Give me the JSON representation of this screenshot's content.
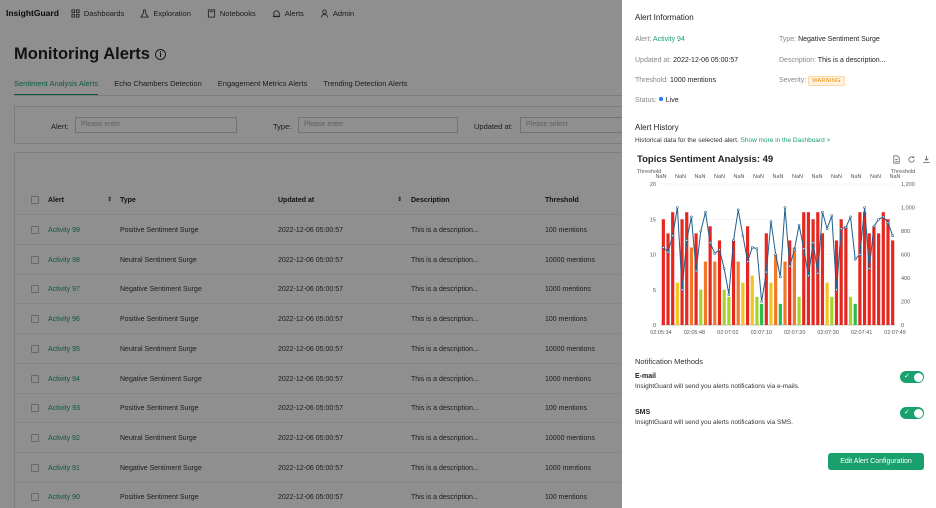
{
  "nav": {
    "brand": "InsightGuard",
    "items": [
      {
        "label": "Dashboards",
        "icon": "dashboard-icon"
      },
      {
        "label": "Exploration",
        "icon": "flask-icon"
      },
      {
        "label": "Notebooks",
        "icon": "notebook-icon"
      },
      {
        "label": "Alerts",
        "icon": "alert-icon"
      },
      {
        "label": "Admin",
        "icon": "user-icon"
      }
    ]
  },
  "page": {
    "title": "Monitoring Alerts"
  },
  "tabs": [
    "Sentiment Analysis Alerts",
    "Echo Chambers Detection",
    "Engagement Metrics Alerts",
    "Trending Detection Alerts"
  ],
  "filters": {
    "alert_label": "Alert:",
    "alert_placeholder": "Please enter",
    "type_label": "Type:",
    "type_placeholder": "Please enter",
    "updated_label": "Updated at:",
    "updated_placeholder": "Please select"
  },
  "table": {
    "headers": {
      "alert": "Alert",
      "type": "Type",
      "updated": "Updated at",
      "description": "Description",
      "threshold": "Threshold"
    },
    "rows": [
      {
        "alert": "Activity 99",
        "type": "Positive Sentiment Surge",
        "updated": "2022-12-06 05:00:57",
        "description": "This is a description...",
        "threshold": "100 mentions"
      },
      {
        "alert": "Activity 98",
        "type": "Neutral Sentiment Surge",
        "updated": "2022-12-06 05:00:57",
        "description": "This is a description...",
        "threshold": "10000 mentions"
      },
      {
        "alert": "Activity 97",
        "type": "Negative Sentiment Surge",
        "updated": "2022-12-06 05:00:57",
        "description": "This is a description...",
        "threshold": "1000 mentions"
      },
      {
        "alert": "Activity 96",
        "type": "Positive Sentiment Surge",
        "updated": "2022-12-06 05:00:57",
        "description": "This is a description...",
        "threshold": "100 mentions"
      },
      {
        "alert": "Activity 95",
        "type": "Neutral Sentiment Surge",
        "updated": "2022-12-06 05:00:57",
        "description": "This is a description...",
        "threshold": "10000 mentions"
      },
      {
        "alert": "Activity 94",
        "type": "Negative Sentiment Surge",
        "updated": "2022-12-06 05:00:57",
        "description": "This is a description...",
        "threshold": "1000 mentions"
      },
      {
        "alert": "Activity 93",
        "type": "Positive Sentiment Surge",
        "updated": "2022-12-06 05:00:57",
        "description": "This is a description...",
        "threshold": "100 mentions"
      },
      {
        "alert": "Activity 92",
        "type": "Neutral Sentiment Surge",
        "updated": "2022-12-06 05:00:57",
        "description": "This is a description...",
        "threshold": "10000 mentions"
      },
      {
        "alert": "Activity 91",
        "type": "Negative Sentiment Surge",
        "updated": "2022-12-06 05:00:57",
        "description": "This is a description...",
        "threshold": "1000 mentions"
      },
      {
        "alert": "Activity 90",
        "type": "Positive Sentiment Surge",
        "updated": "2022-12-06 05:00:57",
        "description": "This is a description...",
        "threshold": "100 mentions"
      }
    ]
  },
  "panel": {
    "info_title": "Alert Information",
    "alert_key": "Alert:",
    "alert_val": "Activity 94",
    "type_key": "Type:",
    "type_val": "Negative Sentiment Surge",
    "updated_key": "Updated at:",
    "updated_val": "2022-12-06 05:00:57",
    "desc_key": "Description:",
    "desc_val": "This is a description...",
    "threshold_key": "Threshold:",
    "threshold_val": "1000 mentions",
    "severity_key": "Severity:",
    "severity_val": "WARNING",
    "status_key": "Status:",
    "status_val": "Live",
    "history_title": "Alert History",
    "history_desc": "Historical data for the selected alert.",
    "history_link": "Show more in the Dashboard >",
    "notif_title": "Notification Methods",
    "email_name": "E-mail",
    "email_desc": "InsightGuard will send you alerts notifications via e-mails.",
    "email_enabled": true,
    "sms_name": "SMS",
    "sms_desc": "InsightGuard will send you alerts notifications via SMS.",
    "sms_enabled": true,
    "edit_button": "Edit Alert Configuration"
  },
  "colors": {
    "accent": "#1aa06d",
    "warning": "#f08a00",
    "line": "#1f5f8b"
  },
  "chart_data": {
    "type": "bar",
    "title": "Topics Sentiment Analysis: 49",
    "left_axis_label": "Threshold",
    "right_axis_label": "Threshold",
    "top_labels": "NaN",
    "y_left": {
      "ticks": [
        0,
        5,
        10,
        15,
        20
      ],
      "lim": [
        0,
        20
      ]
    },
    "y_right": {
      "ticks": [
        "0",
        "200",
        "400",
        "600",
        "800",
        "1,000",
        "1,200"
      ],
      "lim": [
        0,
        1200
      ]
    },
    "x_ticks": [
      "02:05:34",
      "02:05:48",
      "02:07:02",
      "02:07:10",
      "02:07:20",
      "02:07:30",
      "02:07:41",
      "02:07:49"
    ],
    "bar_values": [
      15,
      13,
      16,
      6,
      15,
      16,
      11,
      13,
      5,
      9,
      14,
      9,
      12,
      5,
      4,
      12,
      9,
      6,
      14,
      7,
      4,
      3,
      13,
      6,
      10,
      3,
      9,
      12,
      11,
      4,
      16,
      16,
      15,
      16,
      13,
      6,
      4,
      12,
      15,
      14,
      4,
      3,
      16,
      16,
      13,
      14,
      13,
      16,
      15,
      12
    ],
    "line_values": [
      660,
      620,
      760,
      1000,
      300,
      720,
      920,
      460,
      800,
      960,
      700,
      610,
      640,
      480,
      260,
      720,
      980,
      760,
      540,
      660,
      650,
      200,
      450,
      880,
      600,
      410,
      1000,
      500,
      640,
      850,
      650,
      420,
      700,
      440,
      960,
      820,
      930,
      300,
      820,
      830,
      920,
      560,
      600,
      1000,
      480,
      840,
      900,
      920,
      870,
      760
    ],
    "series": [
      {
        "name": "",
        "color_scale": [
          "#e6261f",
          "#f07826",
          "#f3c421",
          "#a5d22d",
          "#2bbd4a"
        ]
      }
    ]
  }
}
